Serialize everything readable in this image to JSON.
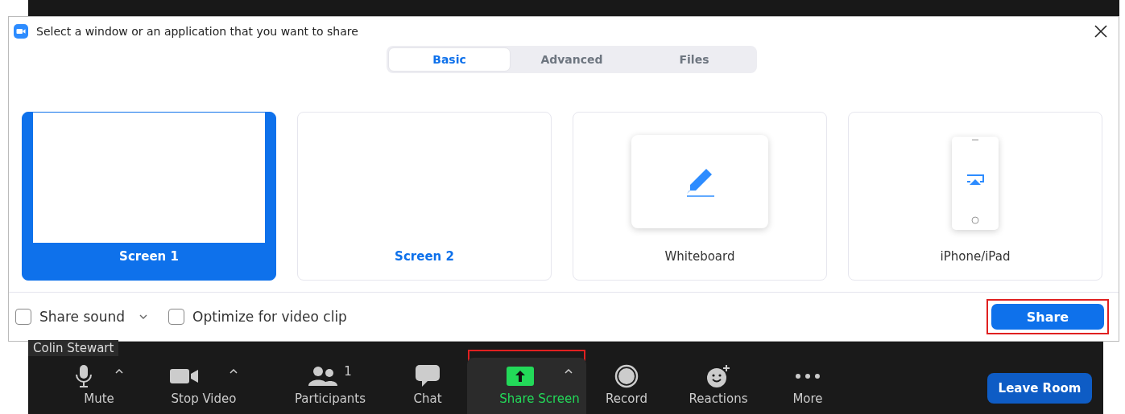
{
  "dialog": {
    "title": "Select a window or an application that you want to share"
  },
  "tabs": [
    {
      "label": "Basic",
      "selected": true
    },
    {
      "label": "Advanced",
      "selected": false
    },
    {
      "label": "Files",
      "selected": false
    }
  ],
  "cards": [
    {
      "kind": "screen",
      "label": "Screen 1",
      "selected": true
    },
    {
      "kind": "screen",
      "label": "Screen 2",
      "selected": false
    },
    {
      "kind": "whiteboard",
      "label": "Whiteboard",
      "selected": false
    },
    {
      "kind": "device",
      "label": "iPhone/iPad",
      "selected": false
    }
  ],
  "options": [
    {
      "label": "Share sound",
      "checked": false,
      "has_menu": true
    },
    {
      "label": "Optimize for video clip",
      "checked": false,
      "has_menu": false
    }
  ],
  "share_button": {
    "label": "Share",
    "highlighted": true
  },
  "name_tag": "Colin Stewart",
  "toolbar": [
    {
      "kind": "mic",
      "label": "Mute",
      "caret": true,
      "active": false,
      "highlighted": false
    },
    {
      "kind": "camera",
      "label": "Stop Video",
      "caret": true,
      "active": false,
      "highlighted": false
    },
    {
      "kind": "people",
      "label": "Participants",
      "count": "1",
      "caret": false,
      "active": false,
      "highlighted": false
    },
    {
      "kind": "chat",
      "label": "Chat",
      "caret": false,
      "active": false,
      "highlighted": false
    },
    {
      "kind": "share",
      "label": "Share Screen",
      "caret": true,
      "active": true,
      "highlighted": true
    },
    {
      "kind": "record",
      "label": "Record",
      "caret": false,
      "active": false,
      "highlighted": false
    },
    {
      "kind": "reaction",
      "label": "Reactions",
      "caret": false,
      "active": false,
      "highlighted": false
    },
    {
      "kind": "more",
      "label": "More",
      "caret": false,
      "active": false,
      "highlighted": false
    }
  ],
  "leave_button": {
    "label": "Leave Room"
  }
}
